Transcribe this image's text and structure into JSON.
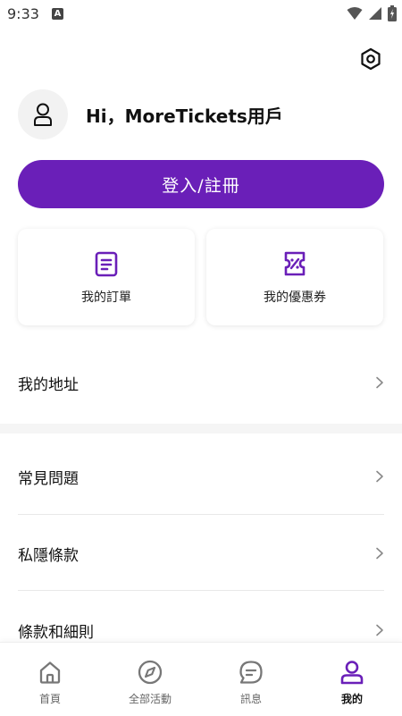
{
  "status_bar": {
    "time": "9:33",
    "notification_letter": "A"
  },
  "profile": {
    "greeting": "Hi，MoreTickets用戶"
  },
  "login_button": {
    "label": "登入/註冊"
  },
  "quick_links": [
    {
      "label": "我的訂單",
      "icon": "clipboard-icon"
    },
    {
      "label": "我的優惠券",
      "icon": "coupon-icon"
    }
  ],
  "menu": [
    {
      "label": "我的地址"
    },
    {
      "label": "常見問題"
    },
    {
      "label": "私隱條款"
    },
    {
      "label": "條款和細則"
    }
  ],
  "bottom_nav": [
    {
      "label": "首頁",
      "icon": "home-icon",
      "active": false
    },
    {
      "label": "全部活動",
      "icon": "compass-icon",
      "active": false
    },
    {
      "label": "訊息",
      "icon": "chat-icon",
      "active": false
    },
    {
      "label": "我的",
      "icon": "person-icon",
      "active": true
    }
  ],
  "colors": {
    "accent": "#6a1fb8",
    "inactive": "#777777",
    "section_gap": "#f5f5f5"
  }
}
